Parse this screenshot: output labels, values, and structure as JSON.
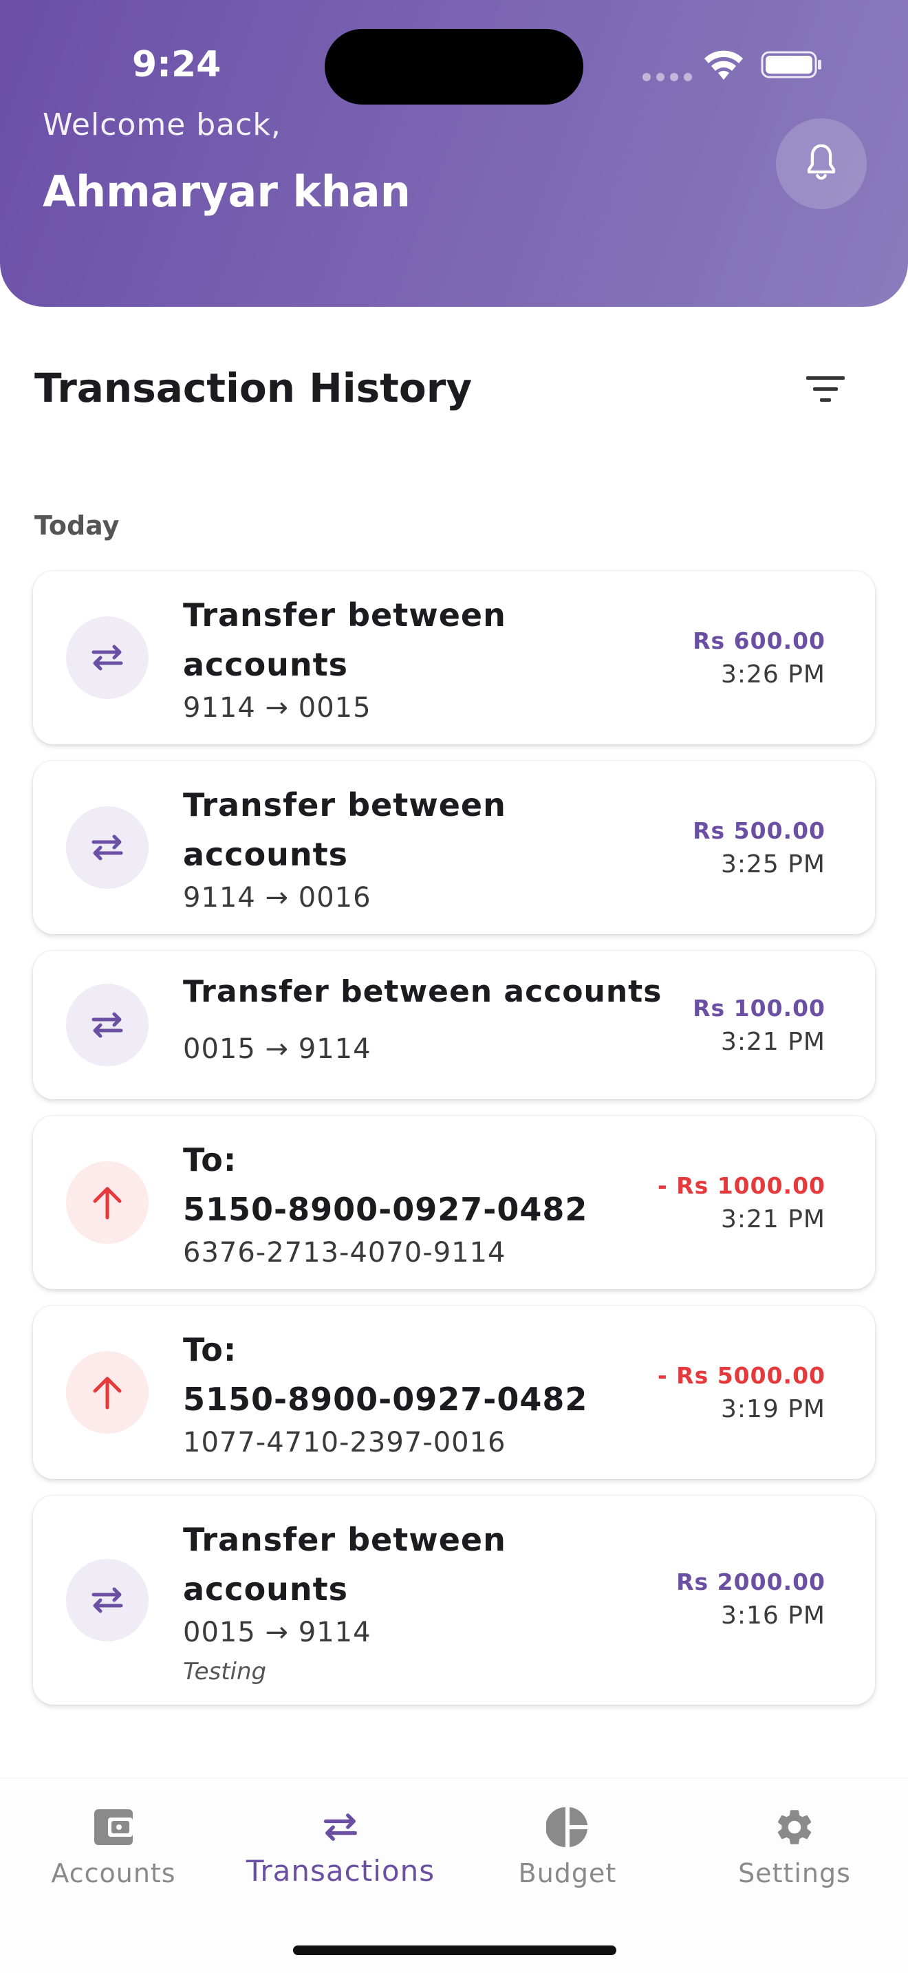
{
  "status_bar": {
    "time": "9:24"
  },
  "header": {
    "welcome": "Welcome back,",
    "user_name": "Ahmaryar khan",
    "notifications_icon": "bell-icon"
  },
  "page": {
    "title": "Transaction History",
    "filter_icon": "filter-icon",
    "group_label": "Today"
  },
  "transactions": [
    {
      "kind": "transfer",
      "title_line1": "Transfer between",
      "title_line2": "accounts",
      "detail": "9114 → 0015",
      "amount": "Rs 600.00",
      "time": "3:26 PM"
    },
    {
      "kind": "transfer",
      "title_line1": "Transfer between",
      "title_line2": "accounts",
      "detail": "9114 → 0016",
      "amount": "Rs 500.00",
      "time": "3:25 PM"
    },
    {
      "kind": "transfer",
      "title_line1": "Transfer between accounts",
      "detail": "0015 → 9114",
      "amount": "Rs 100.00",
      "time": "3:21 PM"
    },
    {
      "kind": "outgoing",
      "title_line1": "To:",
      "title_line2": "5150-8900-0927-0482",
      "detail": "6376-2713-4070-9114",
      "amount": "- Rs 1000.00",
      "time": "3:21 PM"
    },
    {
      "kind": "outgoing",
      "title_line1": "To:",
      "title_line2": "5150-8900-0927-0482",
      "detail": "1077-4710-2397-0016",
      "amount": "- Rs 5000.00",
      "time": "3:19 PM"
    },
    {
      "kind": "transfer",
      "title_line1": "Transfer between",
      "title_line2": "accounts",
      "detail": "0015 → 9114",
      "note": "Testing",
      "amount": "Rs 2000.00",
      "time": "3:16 PM"
    }
  ],
  "bottom_nav": [
    {
      "label": "Accounts",
      "icon": "wallet-icon",
      "active": false
    },
    {
      "label": "Transactions",
      "icon": "swap-icon",
      "active": true
    },
    {
      "label": "Budget",
      "icon": "pie-chart-icon",
      "active": false
    },
    {
      "label": "Settings",
      "icon": "gear-icon",
      "active": false
    }
  ],
  "colors": {
    "primary": "#6a4fa3",
    "header_start": "#6b4fa8",
    "header_end": "#8a7cbd",
    "debit": "#e5393b",
    "nav_inactive": "#8a8a8a"
  }
}
